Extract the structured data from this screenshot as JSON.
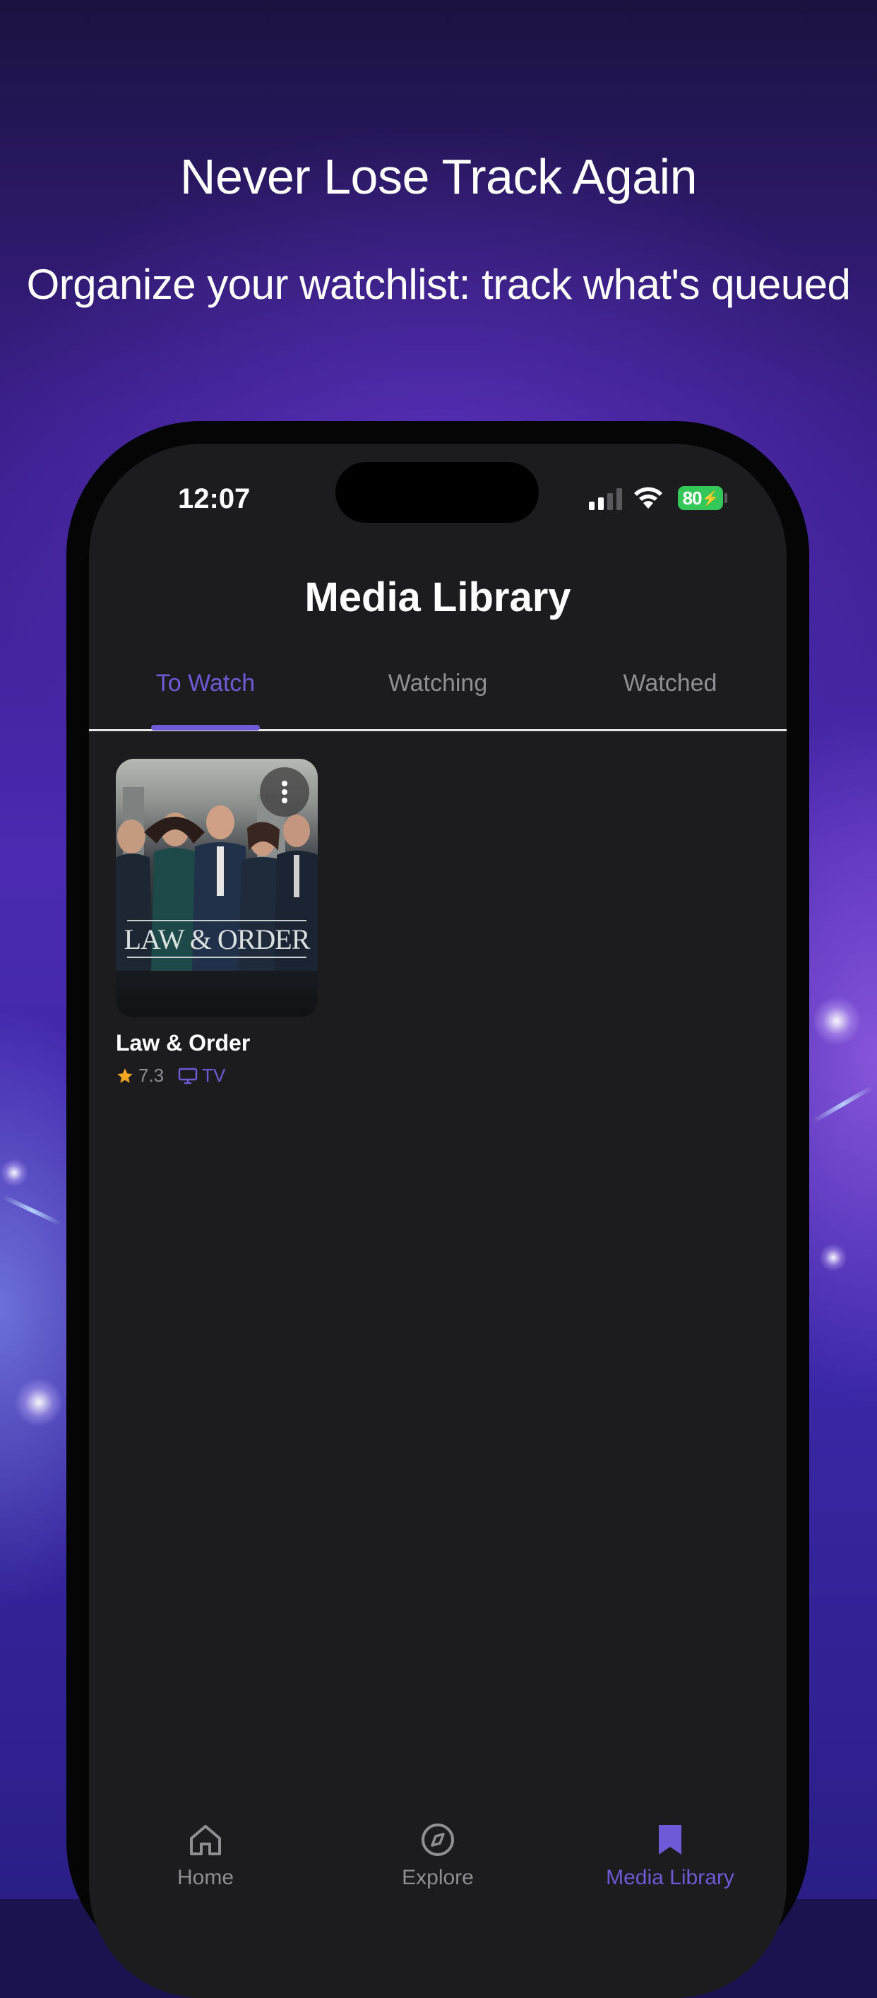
{
  "promo": {
    "headline": "Never Lose Track Again",
    "subline": "Organize your watchlist: track what's queued"
  },
  "status_bar": {
    "time": "12:07",
    "battery": "80"
  },
  "header": {
    "title": "Media Library"
  },
  "tabs": [
    {
      "label": "To Watch",
      "active": true
    },
    {
      "label": "Watching",
      "active": false
    },
    {
      "label": "Watched",
      "active": false
    }
  ],
  "items": [
    {
      "title": "Law & Order",
      "poster_text": "LAW & ORDER",
      "rating": "7.3",
      "type": "TV"
    }
  ],
  "bottom_nav": [
    {
      "label": "Home",
      "icon": "home-icon",
      "active": false
    },
    {
      "label": "Explore",
      "icon": "compass-icon",
      "active": false
    },
    {
      "label": "Media Library",
      "icon": "bookmark-icon",
      "active": true
    }
  ],
  "colors": {
    "accent": "#6e5ad6",
    "star": "#f5a623",
    "battery": "#34c759",
    "screen_bg": "#1c1c1e"
  }
}
